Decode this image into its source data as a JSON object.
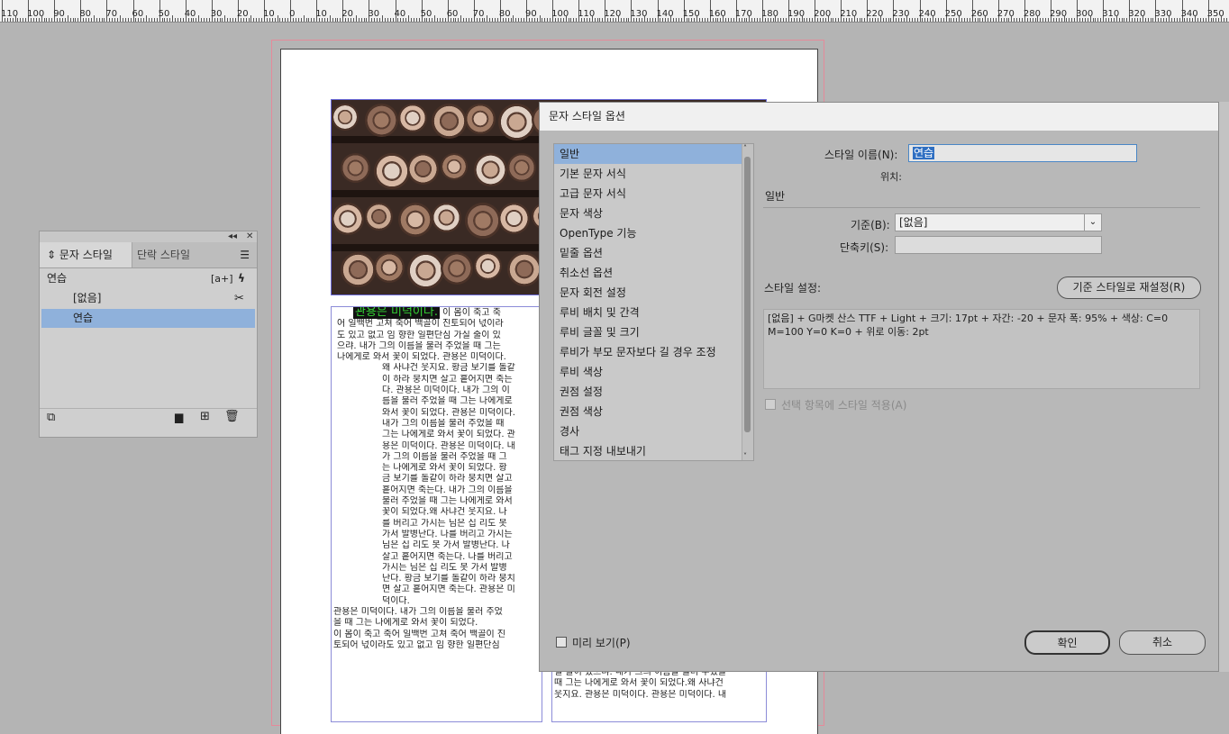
{
  "ruler": {
    "labels": [
      "110",
      "100",
      "90",
      "80",
      "70",
      "60",
      "50",
      "40",
      "30",
      "20",
      "10",
      "0",
      "10",
      "20",
      "30",
      "40",
      "50",
      "60",
      "70",
      "80",
      "90",
      "100",
      "110",
      "120",
      "130",
      "140",
      "150",
      "160",
      "170",
      "180",
      "190",
      "200",
      "210",
      "220",
      "230",
      "240",
      "250",
      "260",
      "270",
      "280",
      "290",
      "300",
      "310",
      "320",
      "330",
      "340",
      "350",
      "360"
    ]
  },
  "document": {
    "heading": "관용은 미덕이다.",
    "heading_tail": " 이 몸이 죽고 죽",
    "lines": [
      "어 일백번 고쳐 죽어 백골이 진토되어 넋이라",
      "도 있고 없고 임 향한 일편단심 가실 줄이 있",
      "으랴. 내가 그의 이름을 불러 주었을 때 그는",
      "나에게로 와서 꽃이 되었다. 관용은 미덕이다."
    ],
    "indented_lines": [
      "왜 사냐건 웃지요. 황금 보기를 돌같",
      "이 하라 뭉치면 살고 흩어지면 죽는",
      "다. 관용은 미덕이다. 내가 그의 이",
      "름을 불러 주었을 때 그는 나에게로",
      "와서 꽃이 되었다. 관용은 미덕이다.",
      "내가 그의 이름을 불러 주었을 때",
      "그는 나에게로 와서 꽃이 되었다. 관",
      "용은 미덕이다. 관용은 미덕이다. 내",
      "가 그의 이름을 불러 주었을 때 그",
      "는 나에게로 와서 꽃이 되었다. 황",
      "금 보기를 돌같이 하라 뭉치면 살고",
      "흩어지면 죽는다. 내가 그의 이름을",
      "불러 주었을 때 그는 나에게로 와서",
      "꽃이 되었다.왜 사냐건 웃지요. 나",
      "를 버리고 가시는 님은 십 리도 못",
      "가서 발병난다. 나를 버리고 가시는",
      "님은 십 리도 못 가서 발병난다. 나",
      "살고 흩어지면 죽는다. 나를 버리고",
      "가시는 님은 십 리도 못 가서 발병",
      "난다. 황금 보기를 돌같이 하라 뭉치",
      "면 살고 흩어지면 죽는다. 관용은 미",
      "덕이다."
    ],
    "tail_lines": [
      "관용은 미덕이다. 내가 그의 이름을 불러 주었",
      "을 때 그는 나에게로 와서 꽃이 되었다.",
      " 이 몸이 죽고 죽어 일백번 고쳐 죽어 백골이 진",
      "토되어 넋이라도 있고 없고 임 향한 일편단심"
    ],
    "col2_lines": [
      "실 줄이 있으랴. 내가 그의 이름을 불러 주었을",
      "때 그는 나에게로 와서 꽃이 되었다.왜 사냐건",
      "웃지요. 관용은 미덕이다. 관용은 미덕이다. 내"
    ]
  },
  "styles_panel": {
    "collapse_label": "◂◂",
    "close_label": "✕",
    "tab_active": "문자 스타일",
    "tab_inactive": "단락 스타일",
    "current_style": "연습",
    "quick_apply": "[a+]",
    "items": [
      "[없음]",
      "연습"
    ],
    "selected_index": 1
  },
  "dialog": {
    "title": "문자 스타일 옵션",
    "categories": [
      "일반",
      "기본 문자 서식",
      "고급 문자 서식",
      "문자 색상",
      "OpenType 기능",
      "밑줄 옵션",
      "취소선 옵션",
      "문자 회전 설정",
      "루비 배치 및 간격",
      "루비 글꼴 및 크기",
      "루비가 부모 문자보다 길 경우 조정",
      "루비 색상",
      "권점 설정",
      "권점 색상",
      "경사",
      "태그 지정 내보내기"
    ],
    "selected_category": 0,
    "style_name_label": "스타일 이름(N):",
    "style_name_value": "연습",
    "location_label": "위치:",
    "section_general": "일반",
    "based_on_label": "기준(B):",
    "based_on_value": "[없음]",
    "shortcut_label": "단축키(S):",
    "shortcut_value": "",
    "style_settings_label": "스타일 설정:",
    "reset_button": "기준 스타일로 재설정(R)",
    "settings_text": "[없음] + G마켓 산스 TTF + Light + 크기: 17pt + 자간: -20 + 문자 폭: 95% + 색상: C=0 M=100 Y=0 K=0 + 위로 이동: 2pt",
    "apply_to_selection": "선택 항목에 스타일 적용(A)",
    "preview_label": "미리 보기(P)",
    "ok_button": "확인",
    "cancel_button": "취소"
  }
}
